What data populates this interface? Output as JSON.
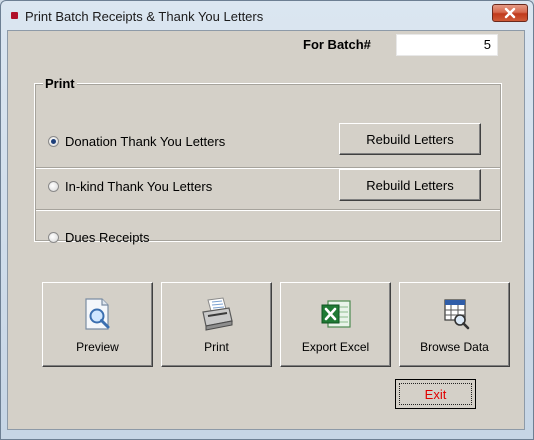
{
  "window": {
    "title": "Print Batch Receipts & Thank You Letters"
  },
  "batch": {
    "label": "For Batch#",
    "value": "5"
  },
  "print_group": {
    "title": "Print",
    "options": [
      {
        "label": "Donation Thank You Letters",
        "checked": true,
        "button": "Rebuild Letters"
      },
      {
        "label": "In-kind Thank You Letters",
        "checked": false,
        "button": "Rebuild Letters"
      },
      {
        "label": "Dues Receipts",
        "checked": false
      }
    ]
  },
  "actions": [
    {
      "label": "Preview",
      "icon": "magnifier-page-icon"
    },
    {
      "label": "Print",
      "icon": "printer-icon"
    },
    {
      "label": "Export Excel",
      "icon": "excel-icon"
    },
    {
      "label": "Browse Data",
      "icon": "browse-grid-icon"
    }
  ],
  "exit": {
    "label": "Exit",
    "color": "#e00000"
  },
  "colors": {
    "face": "#d4d0c8",
    "frame": "#cfdbe7",
    "close": "#c03a1c"
  }
}
